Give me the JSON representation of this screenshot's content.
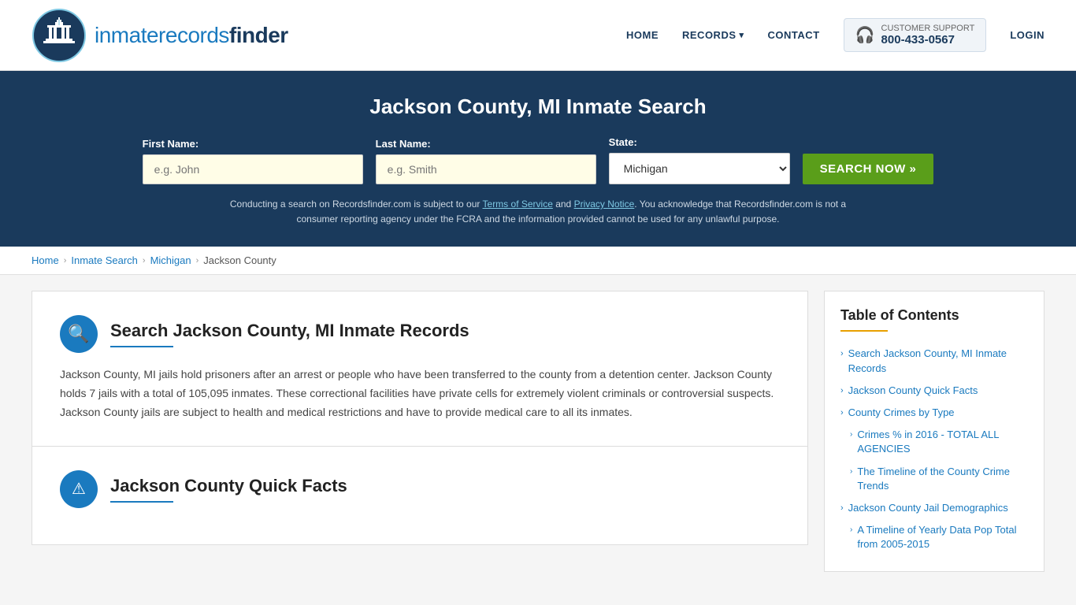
{
  "header": {
    "logo_text_part1": "inmaterecords",
    "logo_text_part2": "finder",
    "nav": {
      "home": "HOME",
      "records": "RECORDS",
      "contact": "CONTACT",
      "login": "LOGIN",
      "support_label": "CUSTOMER SUPPORT",
      "support_number": "800-433-0567"
    }
  },
  "hero": {
    "title": "Jackson County, MI Inmate Search",
    "form": {
      "first_name_label": "First Name:",
      "first_name_placeholder": "e.g. John",
      "last_name_label": "Last Name:",
      "last_name_placeholder": "e.g. Smith",
      "state_label": "State:",
      "state_value": "Michigan",
      "search_button": "SEARCH NOW »"
    },
    "disclaimer": "Conducting a search on Recordsfinder.com is subject to our Terms of Service and Privacy Notice. You acknowledge that Recordsfinder.com is not a consumer reporting agency under the FCRA and the information provided cannot be used for any unlawful purpose."
  },
  "breadcrumb": {
    "home": "Home",
    "inmate_search": "Inmate Search",
    "michigan": "Michigan",
    "current": "Jackson County"
  },
  "main_section": {
    "title": "Search Jackson County, MI Inmate Records",
    "body": "Jackson County, MI jails hold prisoners after an arrest or people who have been transferred to the county from a detention center. Jackson County holds 7 jails with a total of 105,095 inmates. These correctional facilities have private cells for extremely violent criminals or controversial suspects. Jackson County jails are subject to health and medical restrictions and have to provide medical care to all its inmates."
  },
  "second_section": {
    "title": "Jackson County Quick Facts"
  },
  "toc": {
    "title": "Table of Contents",
    "items": [
      {
        "label": "Search Jackson County, MI Inmate Records",
        "sub": false
      },
      {
        "label": "Jackson County Quick Facts",
        "sub": false
      },
      {
        "label": "County Crimes by Type",
        "sub": false
      },
      {
        "label": "Crimes % in 2016 - TOTAL ALL AGENCIES",
        "sub": true
      },
      {
        "label": "The Timeline of the County Crime Trends",
        "sub": true
      },
      {
        "label": "Jackson County Jail Demographics",
        "sub": false
      },
      {
        "label": "A Timeline of Yearly Data Pop Total from 2005-2015",
        "sub": true
      }
    ]
  },
  "icons": {
    "search": "🔍",
    "warning": "⚠",
    "headphones": "🎧",
    "chevron_right": "›",
    "chevron_down": "›"
  }
}
